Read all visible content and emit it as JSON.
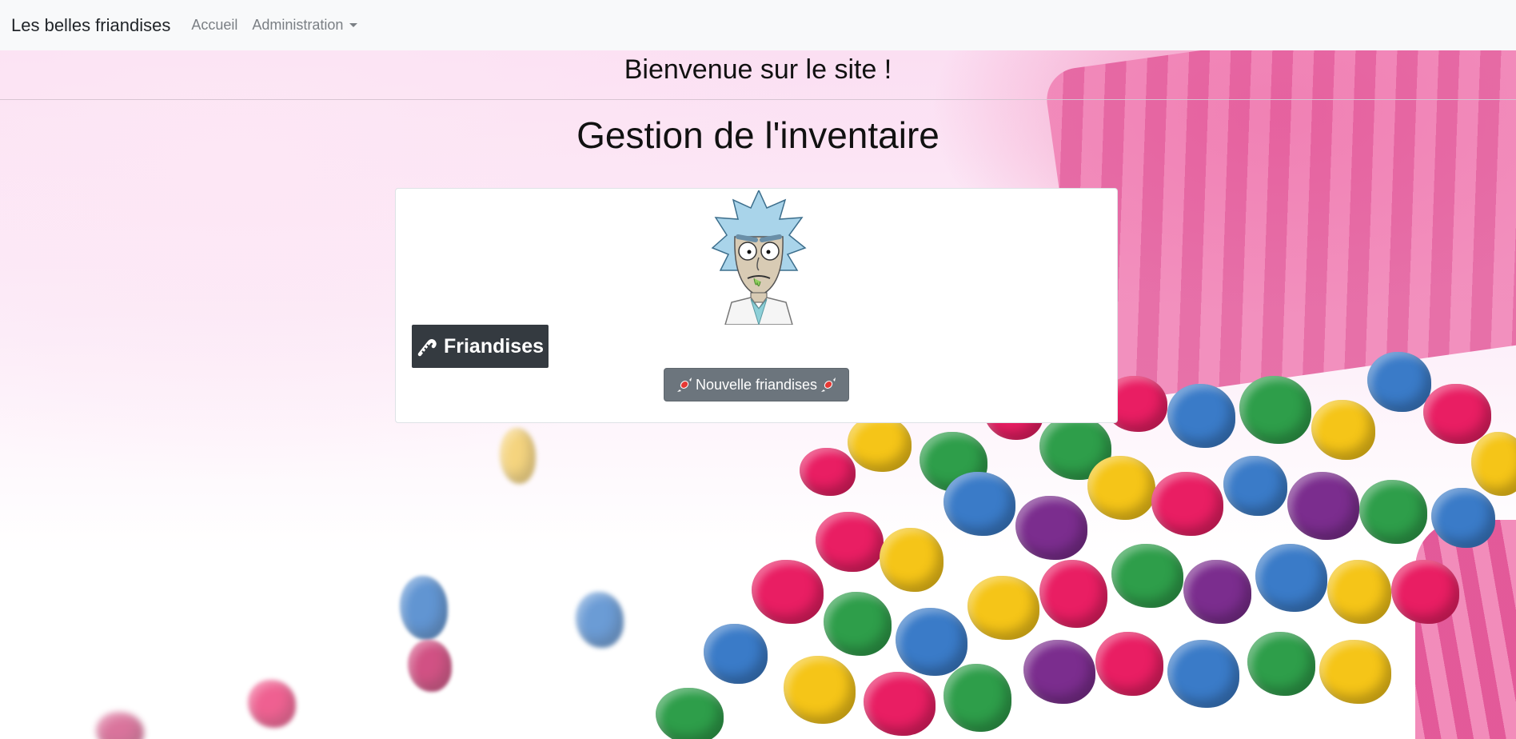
{
  "navbar": {
    "brand": "Les belles friandises",
    "links": [
      {
        "label": "Accueil"
      },
      {
        "label": "Administration"
      }
    ]
  },
  "header": {
    "welcome": "Bienvenue sur le site !",
    "title": "Gestion de l'inventaire"
  },
  "card": {
    "avatar_icon": "rick-character-icon",
    "category_button": {
      "label": "Friandises",
      "icon": "candy-cane-icon"
    },
    "new_button": {
      "label": "Nouvelle friandises",
      "icon": "candy-icon"
    }
  },
  "colors": {
    "navbar_bg": "#f8f9fa",
    "dark_button": "#343a40",
    "secondary_button": "#6c757d"
  }
}
